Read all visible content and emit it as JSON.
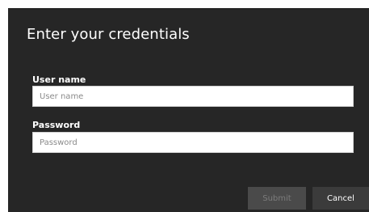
{
  "dialog": {
    "title": "Enter your credentials",
    "username": {
      "label": "User name",
      "placeholder": "User name",
      "value": ""
    },
    "password": {
      "label": "Password",
      "placeholder": "Password",
      "value": ""
    },
    "buttons": {
      "submit_label": "Submit",
      "submit_enabled": false,
      "cancel_label": "Cancel"
    }
  },
  "colors": {
    "dialog_background": "#262626",
    "title_text": "#ffffff",
    "input_background": "#ffffff",
    "submit_disabled_background": "#4a4a4a",
    "submit_disabled_text": "#7c7c7c",
    "cancel_background": "#3b3b3b"
  }
}
